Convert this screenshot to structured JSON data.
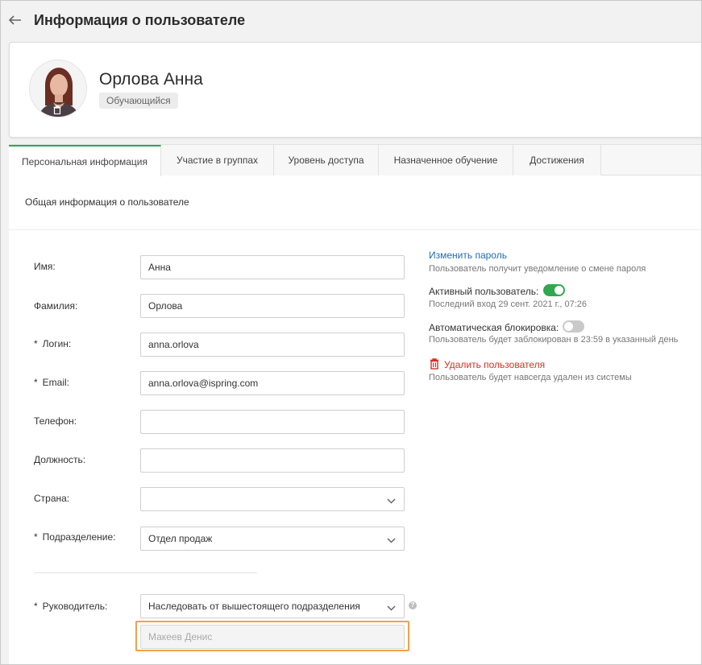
{
  "header": {
    "title": "Информация о пользователе"
  },
  "profile": {
    "name": "Орлова Анна",
    "role": "Обучающийся"
  },
  "tabs": [
    {
      "label": "Персональная информация",
      "active": true
    },
    {
      "label": "Участие в группах",
      "active": false
    },
    {
      "label": "Уровень доступа",
      "active": false
    },
    {
      "label": "Назначенное обучение",
      "active": false
    },
    {
      "label": "Достижения",
      "active": false
    }
  ],
  "section": {
    "title": "Общая информация о пользователе"
  },
  "form": {
    "first_name": {
      "label": "Имя:",
      "value": "Анна"
    },
    "last_name": {
      "label": "Фамилия:",
      "value": "Орлова"
    },
    "login": {
      "label": "Логин:",
      "value": "anna.orlova",
      "required_mark": "*"
    },
    "email": {
      "label": "Email:",
      "value": "anna.orlova@ispring.com",
      "required_mark": "*"
    },
    "phone": {
      "label": "Телефон:",
      "value": ""
    },
    "position": {
      "label": "Должность:",
      "value": ""
    },
    "country": {
      "label": "Страна:",
      "value": ""
    },
    "department": {
      "label": "Подразделение:",
      "value": "Отдел продаж",
      "required_mark": "*"
    },
    "manager": {
      "label": "Руководитель:",
      "value": "Наследовать от вышестоящего подразделения",
      "required_mark": "*",
      "inherited_value": "Макеев Денис",
      "help": "?"
    }
  },
  "side": {
    "change_password": "Изменить пароль",
    "change_password_note": "Пользователь получит уведомление о смене пароля",
    "active_label": "Активный пользователь:",
    "active_on": true,
    "last_login": "Последний вход 29 сент. 2021 г., 07:26",
    "auto_block_label": "Автоматическая блокировка:",
    "auto_block_on": false,
    "auto_block_note": "Пользователь будет заблокирован в 23:59 в указанный день",
    "delete_user": "Удалить пользователя",
    "delete_user_note": "Пользователь будет навсегда удален из системы"
  },
  "colors": {
    "accent": "#2fa84f",
    "link": "#1f6db3",
    "danger": "#d93025",
    "highlight": "#f0a24a"
  }
}
